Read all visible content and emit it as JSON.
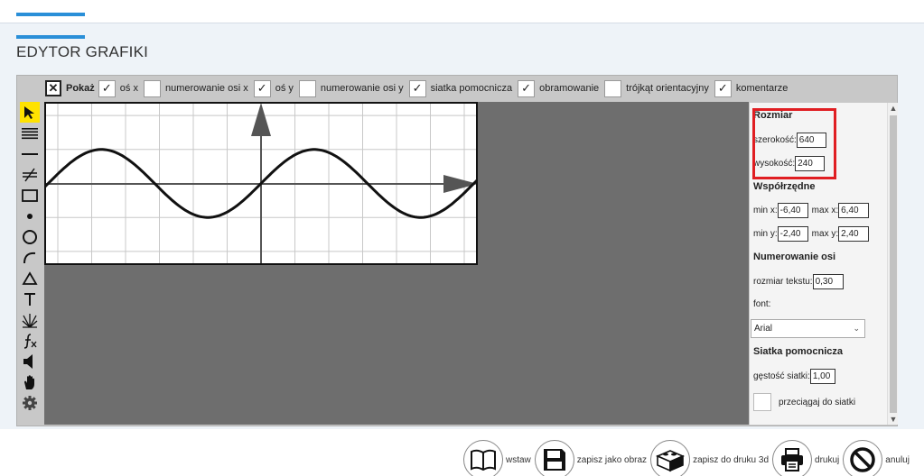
{
  "header": {
    "title": "EDYTOR GRAFIKI"
  },
  "show_bar": {
    "label": "Pokaż",
    "options": [
      {
        "label": "oś x",
        "checked": true
      },
      {
        "label": "numerowanie osi x",
        "checked": false
      },
      {
        "label": "oś y",
        "checked": true
      },
      {
        "label": "numerowanie osi y",
        "checked": false
      },
      {
        "label": "siatka pomocnicza",
        "checked": true
      },
      {
        "label": "obramowanie",
        "checked": true
      },
      {
        "label": "trójkąt orientacyjny",
        "checked": false
      },
      {
        "label": "komentarze",
        "checked": true
      }
    ]
  },
  "tools": [
    {
      "icon": "pointer-icon",
      "active": true
    },
    {
      "icon": "lines-icon"
    },
    {
      "icon": "line-icon"
    },
    {
      "icon": "parallel-lines-icon"
    },
    {
      "icon": "rectangle-icon"
    },
    {
      "icon": "point-icon"
    },
    {
      "icon": "circle-icon"
    },
    {
      "icon": "arc-icon"
    },
    {
      "icon": "triangle-icon"
    },
    {
      "icon": "text-icon"
    },
    {
      "icon": "rays-icon"
    },
    {
      "icon": "function-icon"
    },
    {
      "icon": "speaker-icon"
    },
    {
      "icon": "hand-icon"
    },
    {
      "icon": "gear-icon"
    }
  ],
  "properties": {
    "size": {
      "title": "Rozmiar",
      "width_label": "szerokość:",
      "width": "640",
      "height_label": "wysokość:",
      "height": "240"
    },
    "coords": {
      "title": "Współrzędne",
      "min_x_label": "min x:",
      "min_x": "-6,40",
      "max_x_label": "max x:",
      "max_x": "6,40",
      "min_y_label": "min y:",
      "min_y": "-2,40",
      "max_y_label": "max y:",
      "max_y": "2,40"
    },
    "axis_numbering": {
      "title": "Numerowanie osi",
      "text_size_label": "rozmiar tekstu:",
      "text_size": "0,30",
      "font_label": "font:",
      "font": "Arial"
    },
    "grid": {
      "title": "Siatka pomocnicza",
      "density_label": "gęstość siatki:",
      "density": "1,00",
      "snap_label": "przeciągaj do siatki",
      "snap_checked": false
    }
  },
  "actions": {
    "insert": "wstaw",
    "save_image": "zapisz jako obraz",
    "save_3d": "zapisz do druku 3d",
    "print": "drukuj",
    "cancel": "anuluj"
  }
}
